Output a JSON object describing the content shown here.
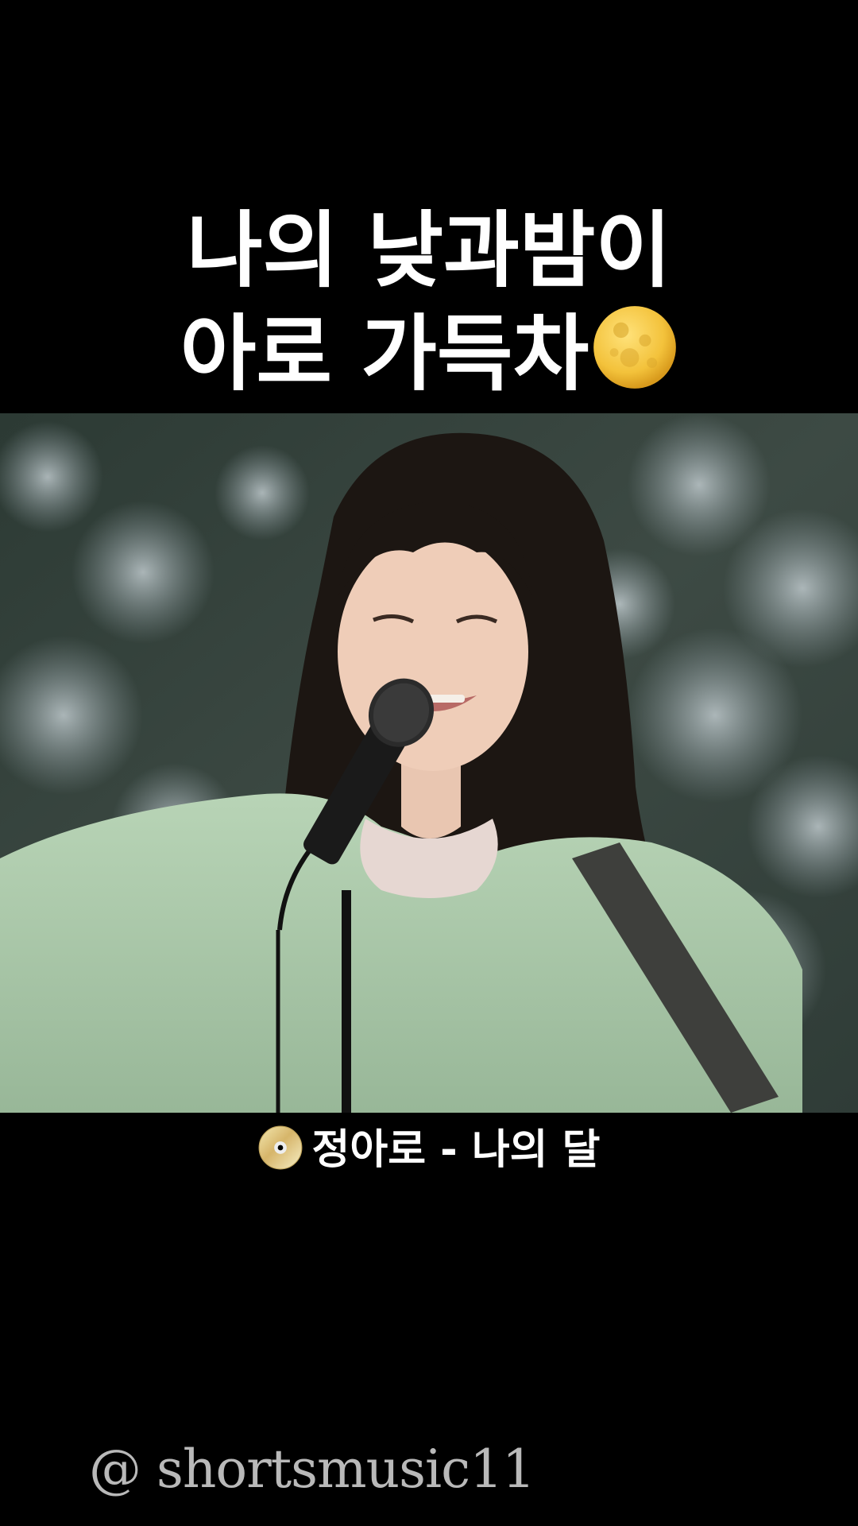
{
  "title": {
    "line1": "나의 낮과밤이",
    "line2": "아로 가득차",
    "emoji": "full-moon-icon"
  },
  "video": {
    "scene": "singer-performance-frame"
  },
  "caption": {
    "icon": "cd-icon",
    "text": "정아로 - 나의 달"
  },
  "watermark": {
    "text": "@ shortsmusic11"
  },
  "colors": {
    "background": "#000000",
    "text": "#ffffff",
    "watermark": "#b9b9b9",
    "moon": "#f3c23b",
    "sweater": "#a9c7a8"
  }
}
